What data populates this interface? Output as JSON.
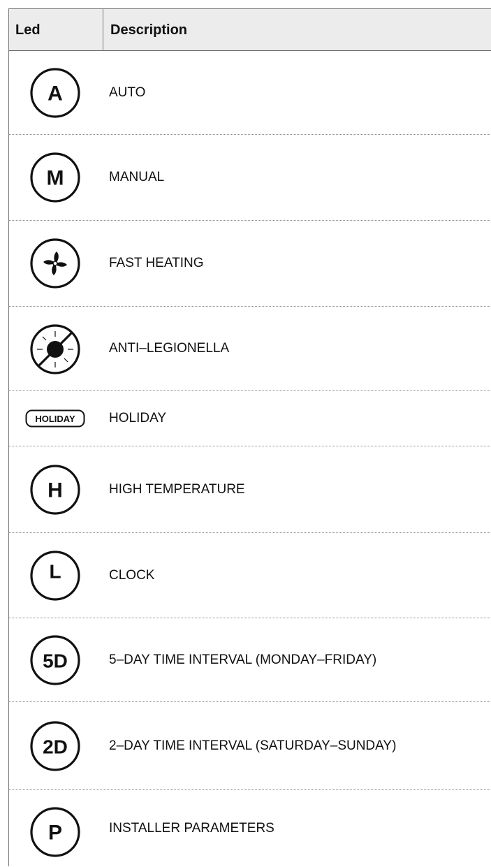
{
  "table": {
    "headers": {
      "led": "Led",
      "description": "Description"
    },
    "rows": [
      {
        "icon": "letter-a-circle-icon",
        "glyph": "A",
        "description": "AUTO"
      },
      {
        "icon": "letter-m-circle-icon",
        "glyph": "M",
        "description": "MANUAL"
      },
      {
        "icon": "fan-circle-icon",
        "glyph": "",
        "description": "FAST HEATING"
      },
      {
        "icon": "sun-crossed-circle-icon",
        "glyph": "",
        "description": "ANTI–LEGIONELLA"
      },
      {
        "icon": "holiday-badge-icon",
        "glyph": "HOLIDAY",
        "description": "HOLIDAY"
      },
      {
        "icon": "letter-h-circle-icon",
        "glyph": "H",
        "description": "HIGH TEMPERATURE"
      },
      {
        "icon": "letter-l-circle-icon",
        "glyph": "L",
        "description": "CLOCK"
      },
      {
        "icon": "5d-circle-icon",
        "glyph": "5D",
        "description": "5–DAY TIME INTERVAL (MONDAY–FRIDAY)"
      },
      {
        "icon": "2d-circle-icon",
        "glyph": "2D",
        "description": "2–DAY TIME INTERVAL (SATURDAY–SUNDAY)"
      },
      {
        "icon": "letter-p-circle-icon",
        "glyph": "P",
        "description": "INSTALLER PARAMETERS"
      }
    ]
  }
}
